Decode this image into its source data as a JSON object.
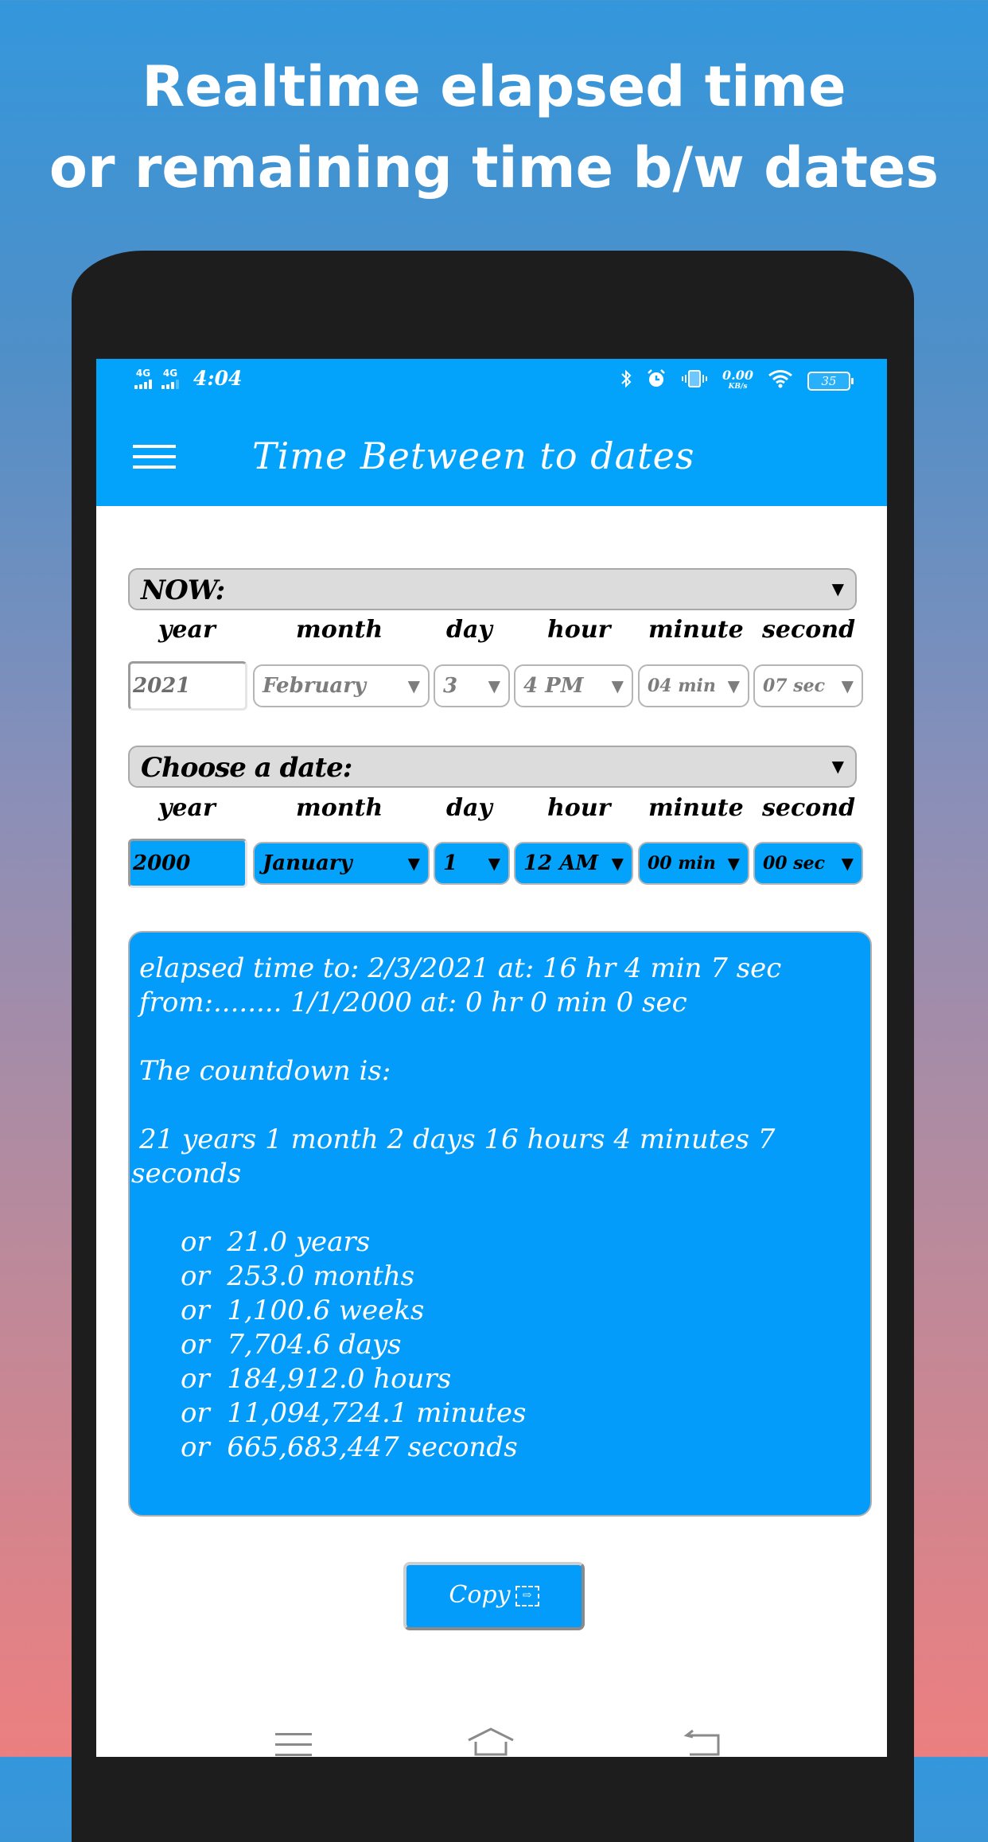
{
  "headline": {
    "line1": "Realtime elapsed time",
    "line2": "or remaining time b/w dates"
  },
  "status_bar": {
    "network1": "4G",
    "network2": "4G",
    "time": "4:04",
    "data_rate": "0.00",
    "data_rate_unit": "KB/s",
    "battery": "35",
    "icons": [
      "bluetooth-icon",
      "alarm-icon",
      "vibrate-icon",
      "wifi-icon",
      "battery-icon"
    ]
  },
  "app_bar": {
    "title": "Time Between to dates",
    "menu_icon": "hamburger-icon"
  },
  "colors": {
    "accent": "#03a3fb",
    "result_bg": "#039cfb",
    "dropdown_bg": "#dcdcdc"
  },
  "now_section": {
    "dropdown_label": "NOW:",
    "column_labels": [
      "year",
      "month",
      "day",
      "hour",
      "minute",
      "second"
    ],
    "year": "2021",
    "month": "February",
    "day": "3",
    "hour": "4 PM",
    "minute": "04 min",
    "second": "07 sec"
  },
  "choose_section": {
    "dropdown_label": "Choose a date:",
    "column_labels": [
      "year",
      "month",
      "day",
      "hour",
      "minute",
      "second"
    ],
    "year": "2000",
    "month": "January",
    "day": "1",
    "hour": "12 AM",
    "minute": "00 min",
    "second": "00 sec"
  },
  "result": {
    "line1": "elapsed time to: 2/3/2021 at: 16 hr 4 min 7 sec",
    "line2": "from:........ 1/1/2000 at: 0 hr 0 min 0 sec",
    "countdown_label": "The countdown is:",
    "countdown": "21 years 1 month 2 days 16 hours 4 minutes 7 seconds",
    "alternatives": [
      "or  21.0 years",
      "or  253.0 months",
      "or  1,100.6 weeks",
      "or  7,704.6 days",
      "or  184,912.0 hours",
      "or  11,094,724.1 minutes",
      "or  665,683,447 seconds"
    ]
  },
  "copy_button": {
    "label": "Copy",
    "icon": "copy-icon"
  },
  "nav_bar": {
    "icons": [
      "menu-icon",
      "home-icon",
      "back-icon"
    ]
  }
}
